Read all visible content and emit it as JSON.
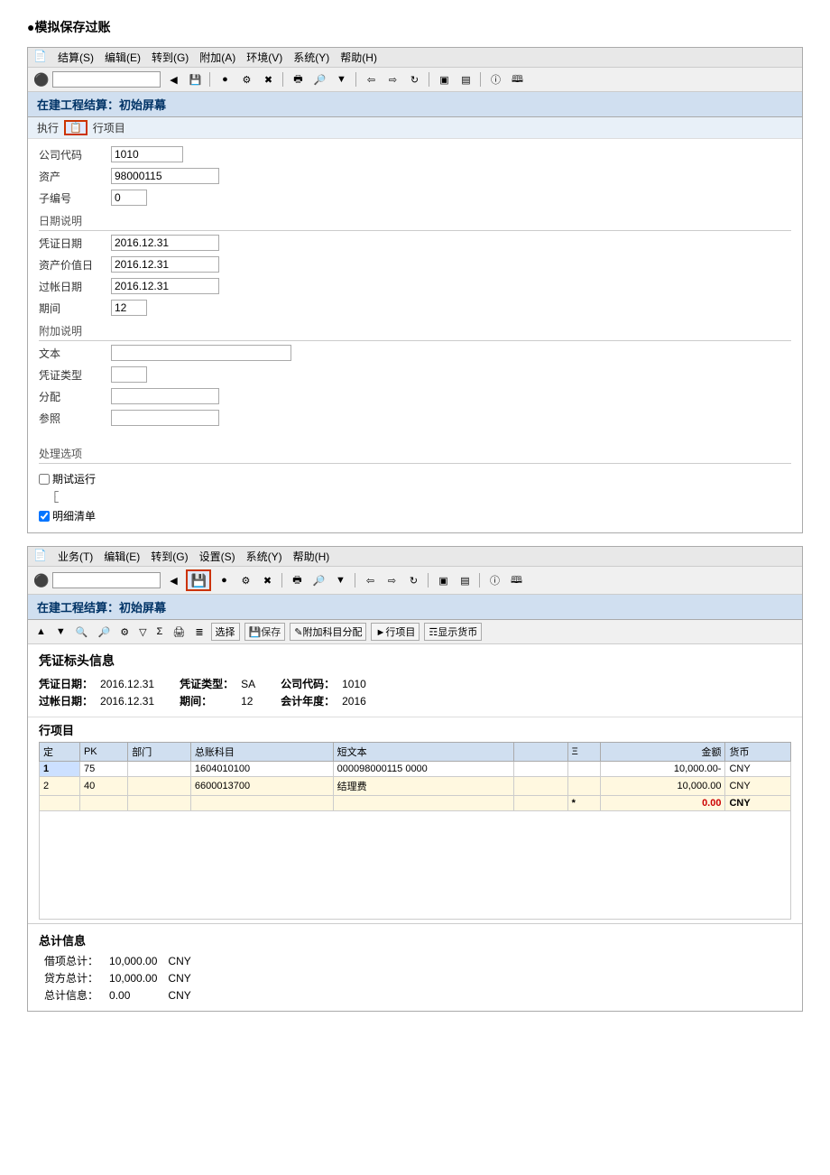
{
  "page": {
    "title": "●模拟保存过账"
  },
  "window1": {
    "menu": {
      "items": [
        "结算(S)",
        "编辑(E)",
        "转到(G)",
        "附加(A)",
        "环境(V)",
        "系统(Y)",
        "帮助(H)"
      ]
    },
    "section_title": "在建工程结算：初始屏幕",
    "subheader": {
      "execute_label": "执行",
      "btn_label": "行项目"
    },
    "form": {
      "company_code_label": "公司代码",
      "company_code_value": "1010",
      "asset_label": "资产",
      "asset_value": "98000115",
      "sub_num_label": "子编号",
      "sub_num_value": "0",
      "date_section": "日期说明",
      "voucher_date_label": "凭证日期",
      "voucher_date_value": "2016.12.31",
      "asset_value_date_label": "资产价值日",
      "asset_value_date_value": "2016.12.31",
      "post_date_label": "过帐日期",
      "post_date_value": "2016.12.31",
      "period_label": "期间",
      "period_value": "12",
      "additional_section": "附加说明",
      "text_label": "文本",
      "text_value": "",
      "voucher_type_label": "凭证类型",
      "voucher_type_value": "",
      "allocation_label": "分配",
      "allocation_value": "",
      "reference_label": "参照",
      "reference_value": "",
      "processing_section": "处理选项",
      "test_run_label": "期试运行",
      "detail_list_label": "明细清单"
    }
  },
  "window2": {
    "menu": {
      "items": [
        "业务(T)",
        "编辑(E)",
        "转到(G)",
        "设置(S)",
        "系统(Y)",
        "帮助(H)"
      ]
    },
    "section_title": "在建工程结算：初始屏幕",
    "toolbar2_items": [
      "▲",
      "▼",
      "搜索",
      "搜索下一个",
      "设置",
      "过滤",
      "汇总",
      "打印",
      "格式",
      "选择",
      "保存",
      "附加科目分配",
      "行项目",
      "显示货币"
    ],
    "voucher_header": {
      "title": "凭证标头信息",
      "voucher_date_label": "凭证日期：",
      "voucher_date_value": "2016.12.31",
      "voucher_type_label": "凭证类型：",
      "voucher_type_value": "SA",
      "company_code_label": "公司代码：",
      "company_code_value": "1010",
      "post_date_label": "过帐日期：",
      "post_date_value": "2016.12.31",
      "period_label": "期间：",
      "period_value": "12",
      "fiscal_year_label": "会计年度：",
      "fiscal_year_value": "2016"
    },
    "line_items": {
      "title": "行项目",
      "columns": [
        "定",
        "PK",
        "部门",
        "总账科目",
        "短文本",
        "",
        "Ξ",
        "金额",
        "货币"
      ],
      "rows": [
        {
          "seq": "1",
          "pk": "75",
          "dept": "",
          "account": "1604010100",
          "short_text": "000098000115 0000",
          "xi": "",
          "amount": "10,000.00-",
          "currency": "CNY"
        },
        {
          "seq": "2",
          "pk": "40",
          "dept": "",
          "account": "6600013700",
          "short_text": "结理费",
          "xi": "",
          "amount": "10,000.00",
          "currency": "CNY"
        }
      ],
      "total_row": {
        "label": "*",
        "amount": "0.00",
        "currency": "CNY"
      }
    },
    "summary": {
      "title": "总计信息",
      "debit_label": "借项总计：",
      "debit_value": "10,000.00",
      "debit_currency": "CNY",
      "credit_label": "贷方总计：",
      "credit_value": "10,000.00",
      "credit_currency": "CNY",
      "total_label": "总计信息：",
      "total_value": "0.00",
      "total_currency": "CNY"
    }
  }
}
